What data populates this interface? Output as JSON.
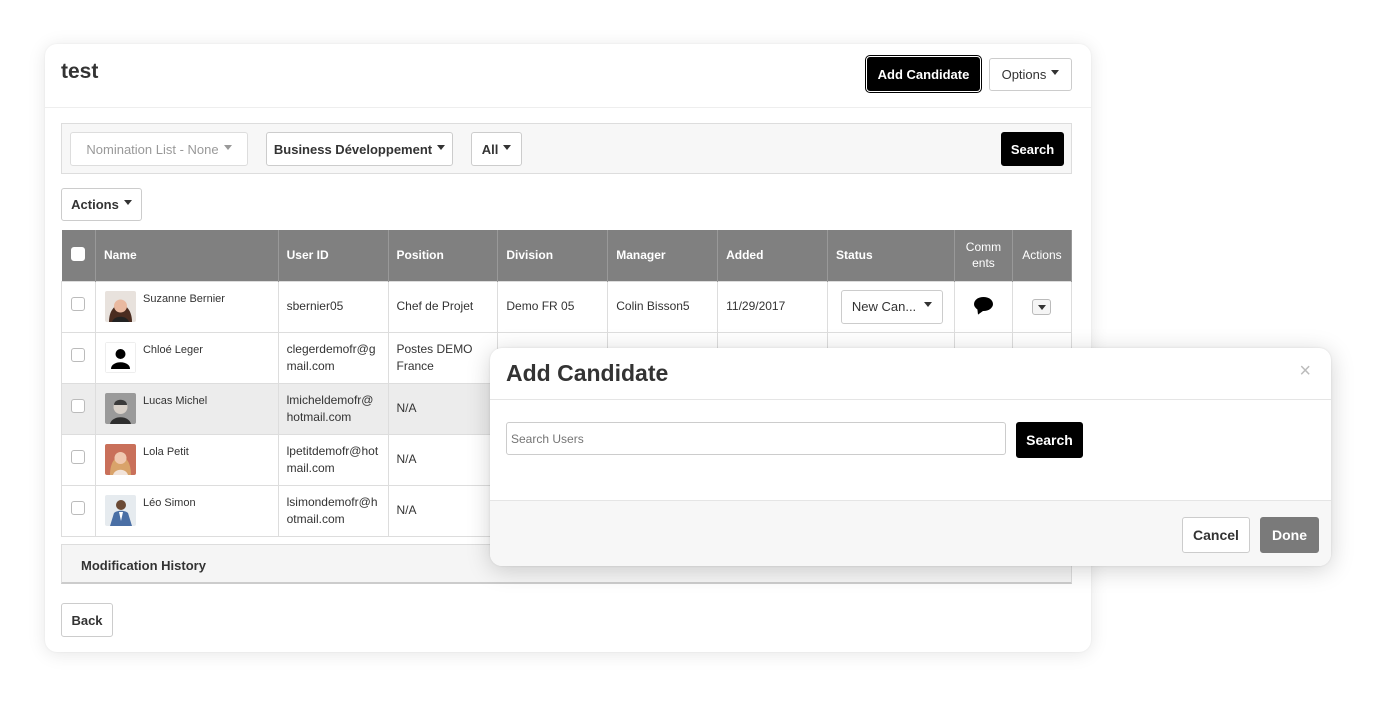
{
  "page": {
    "title": "test"
  },
  "header": {
    "add_candidate_label": "Add Candidate",
    "options_label": "Options"
  },
  "filters": {
    "nomination": "Nomination List - None",
    "department": "Business Développement",
    "all": "All",
    "search_label": "Search"
  },
  "actions_label": "Actions",
  "table": {
    "columns": [
      "Name",
      "User ID",
      "Position",
      "Division",
      "Manager",
      "Added",
      "Status",
      "Comm ents",
      "Actions"
    ],
    "rows": [
      {
        "name": "Suzanne Bernier",
        "user_id": "sbernier05",
        "position": "Chef de Projet",
        "division": "Demo FR 05",
        "manager": "Colin Bisson5",
        "added": "11/29/2017",
        "status": "New Can..."
      },
      {
        "name": "Chloé Leger",
        "user_id": "clegerdemofr@gmail.com",
        "position": "Postes DEMO France",
        "division": "",
        "manager": "",
        "added": "",
        "status": ""
      },
      {
        "name": "Lucas Michel",
        "user_id": "lmicheldemofr@hotmail.com",
        "position": "N/A",
        "division": "",
        "manager": "",
        "added": "",
        "status": ""
      },
      {
        "name": "Lola Petit",
        "user_id": "lpetitdemofr@hotmail.com",
        "position": "N/A",
        "division": "",
        "manager": "",
        "added": "",
        "status": ""
      },
      {
        "name": "Léo Simon",
        "user_id": "lsimondemofr@hotmail.com",
        "position": "N/A",
        "division": "",
        "manager": "",
        "added": "",
        "status": ""
      }
    ]
  },
  "modification_history": "Modification History",
  "back_label": "Back",
  "modal": {
    "title": "Add Candidate",
    "close_glyph": "×",
    "search_placeholder": "Search Users",
    "search_label": "Search",
    "cancel_label": "Cancel",
    "done_label": "Done"
  },
  "colors": {
    "header_gray": "#808080",
    "primary": "#000000",
    "done_gray": "#7a7a7a"
  }
}
